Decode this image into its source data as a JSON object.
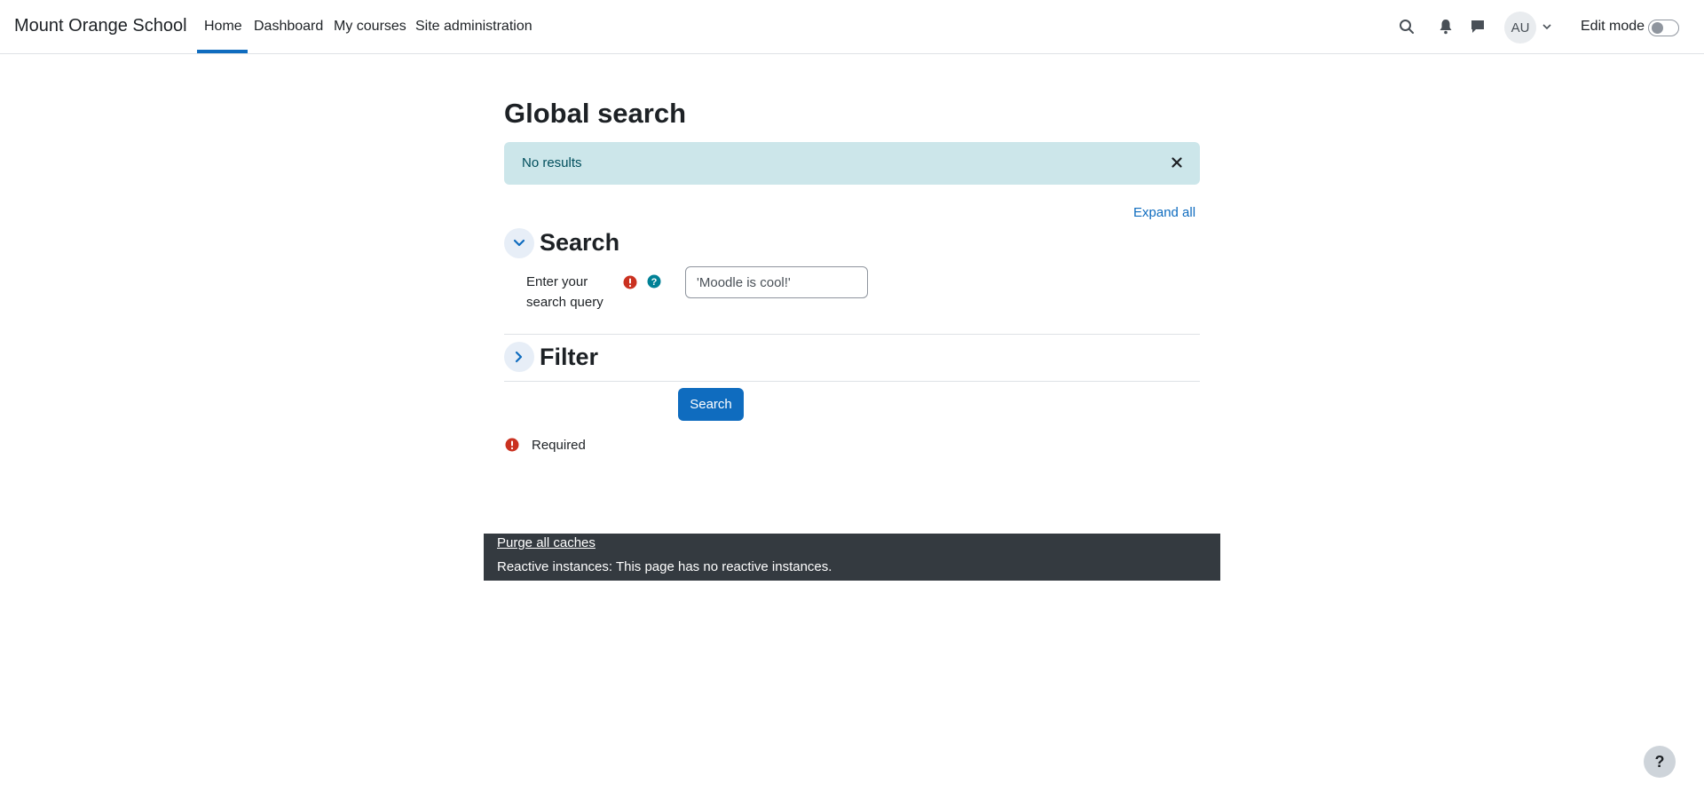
{
  "header": {
    "brand": "Mount Orange School",
    "nav": [
      {
        "label": "Home",
        "active": true
      },
      {
        "label": "Dashboard",
        "active": false
      },
      {
        "label": "My courses",
        "active": false
      },
      {
        "label": "Site administration",
        "active": false
      }
    ],
    "icons": [
      "search-icon",
      "bell-icon",
      "chat-icon"
    ],
    "avatar_initials": "AU",
    "edit_mode_label": "Edit mode",
    "edit_mode_on": false
  },
  "main": {
    "title": "Global search",
    "alert": {
      "text": "No results",
      "close_icon": "close-icon"
    },
    "expand_all": "Expand all",
    "sections": {
      "search": {
        "title": "Search",
        "expanded": true,
        "field_label": "Enter your search query",
        "input_value": "'Moodle is cool!'"
      },
      "filter": {
        "title": "Filter",
        "expanded": false
      }
    },
    "submit_label": "Search",
    "required_label": "Required"
  },
  "footer": {
    "purge_label": "Purge all caches",
    "reactive_text": "Reactive instances: This page has no reactive instances."
  },
  "help_button": "?",
  "colors": {
    "primary": "#0f6cbf",
    "alert_bg": "#cce6ea",
    "alert_text": "#004e5c",
    "required": "#ca3120",
    "help": "#008196",
    "footer_bg": "#343a40"
  }
}
